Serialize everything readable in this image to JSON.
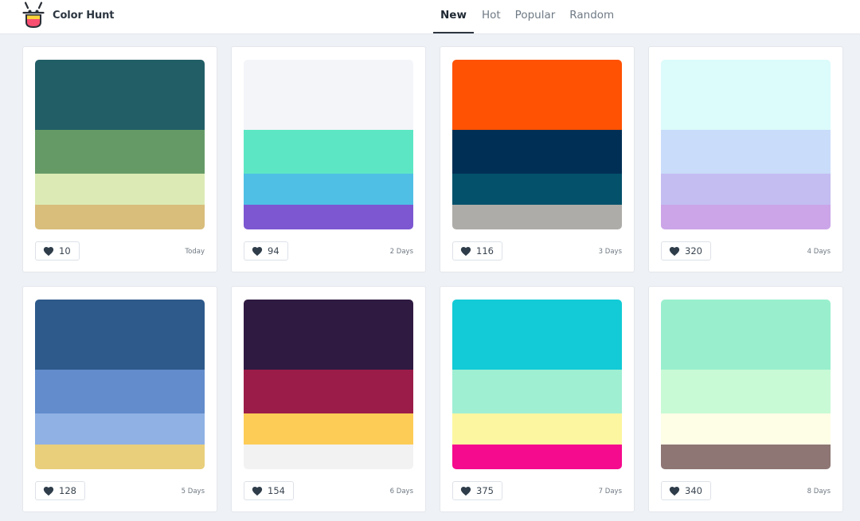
{
  "header": {
    "brand": "Color Hunt",
    "logo_icon": "color-hunt-logo-icon",
    "tabs": [
      {
        "label": "New",
        "active": true
      },
      {
        "label": "Hot",
        "active": false
      },
      {
        "label": "Popular",
        "active": false
      },
      {
        "label": "Random",
        "active": false
      }
    ]
  },
  "icons": {
    "like": "heart-icon"
  },
  "palettes": [
    {
      "colors": [
        "#225e66",
        "#659a67",
        "#dcebb5",
        "#d8bd7b"
      ],
      "likes": "10",
      "date": "Today"
    },
    {
      "colors": [
        "#f4f5f9",
        "#5de6c4",
        "#4fbfe6",
        "#7c57d1"
      ],
      "likes": "94",
      "date": "2 Days"
    },
    {
      "colors": [
        "#ff5202",
        "#002f55",
        "#03516b",
        "#aeaca8"
      ],
      "likes": "116",
      "date": "3 Days"
    },
    {
      "colors": [
        "#dcfbfb",
        "#c9dcfa",
        "#c3bdf1",
        "#cba5e8"
      ],
      "likes": "320",
      "date": "4 Days"
    },
    {
      "colors": [
        "#2d598b",
        "#628ccb",
        "#8fb1e4",
        "#e9cf7c"
      ],
      "likes": "128",
      "date": "5 Days"
    },
    {
      "colors": [
        "#2f1a41",
        "#9b1c49",
        "#fdcc56",
        "#f2f2f2"
      ],
      "likes": "154",
      "date": "6 Days"
    },
    {
      "colors": [
        "#12cbd6",
        "#9fefd3",
        "#fcf6a0",
        "#f50b8d"
      ],
      "likes": "375",
      "date": "7 Days"
    },
    {
      "colors": [
        "#99efcd",
        "#c8fad6",
        "#fefde6",
        "#8d7674"
      ],
      "likes": "340",
      "date": "8 Days"
    }
  ]
}
